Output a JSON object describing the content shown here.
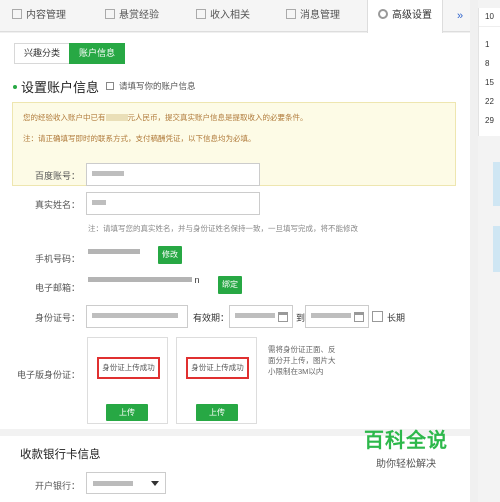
{
  "top_tabs": [
    {
      "label": "内容管理",
      "icon": "list-icon"
    },
    {
      "label": "悬赏经验",
      "icon": "clipboard-icon"
    },
    {
      "label": "收入相关",
      "icon": "wallet-icon"
    },
    {
      "label": "消息管理",
      "icon": "mail-icon"
    },
    {
      "label": "高级设置",
      "icon": "gear-icon",
      "active": true
    }
  ],
  "more_glyph": "»",
  "sub_tabs": [
    {
      "label": "兴趣分类",
      "active": false
    },
    {
      "label": "账户信息",
      "active": true
    }
  ],
  "section": {
    "title": "设置账户信息",
    "hint": "请填写你的账户信息"
  },
  "notice": {
    "line1_prefix": "您的经验收入账户中已有",
    "line1_suffix": "元人民币，提交真实账户信息是提取收入的必要条件。",
    "line2": "注：请正确填写即时的联系方式，支付稿酬凭证，以下信息均为必填。"
  },
  "form": {
    "baidu_label": "百度账号：",
    "realname_label": "真实姓名：",
    "realname_help": "注：请填写您的真实姓名，并与身份证姓名保持一致，一旦填写完成，将不能修改",
    "phone_label": "手机号码：",
    "phone_button": "修改",
    "email_label": "电子邮箱：",
    "email_suffix": "n",
    "email_button": "绑定",
    "id_label": "身份证号：",
    "validity_label": "有效期：",
    "date_sep": "到",
    "longterm_label": "长期",
    "idcard_label": "电子版身份证：",
    "upload_status_front": "身份证上传成功",
    "upload_status_back": "身份证上传成功",
    "upload_button": "上传",
    "upload_note": "需将身份证正面、反面分开上传，图片大小限制在3M以内"
  },
  "bank": {
    "title": "收款银行卡信息",
    "bank_label": "开户银行："
  },
  "calendar": {
    "numbers": [
      "10",
      "1",
      "8",
      "15",
      "22",
      "29"
    ]
  },
  "watermark": {
    "title": "百科全说",
    "subtitle": "助你轻松解决"
  },
  "colors": {
    "accent": "#27a844",
    "error_border": "#e03030",
    "notice_bg": "#fdfbe6",
    "notice_text": "#b07a3a"
  }
}
